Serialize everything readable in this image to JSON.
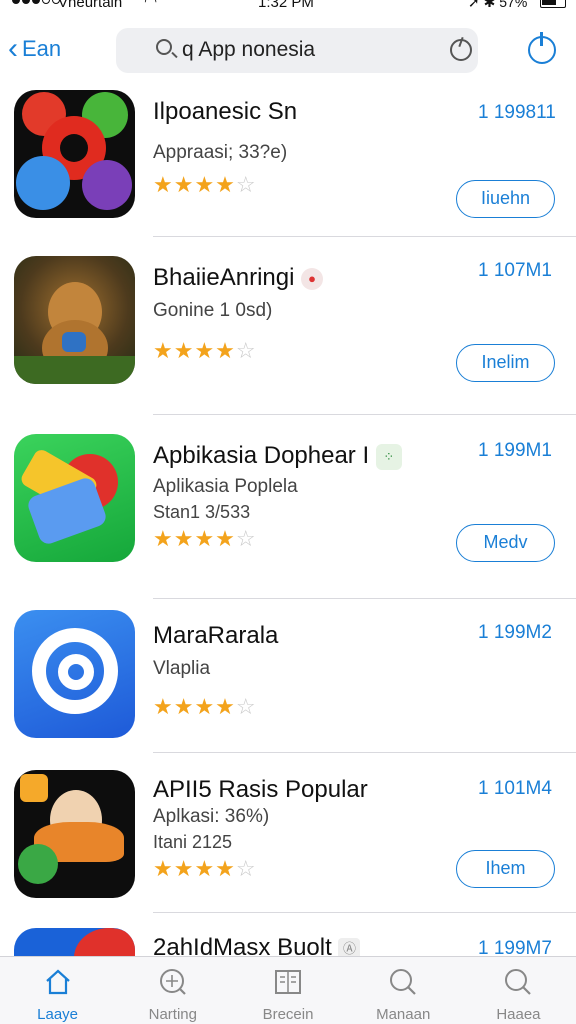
{
  "status_bar": {
    "carrier": "Vneurtain",
    "time": "1:32 PM",
    "battery": "57%"
  },
  "header": {
    "back_label": "Ean",
    "search_value": "q App nonesia"
  },
  "apps": [
    {
      "title": "Ilpoanesic Sn",
      "subtitle": "Appraasi; 33?e)",
      "subtitle2": "",
      "rating": 4,
      "size": "1 199811",
      "button": "Iiuehn"
    },
    {
      "title": "BhaiieAnringi",
      "subtitle": "Gonine 1 0sd)",
      "subtitle2": "",
      "rating": 4,
      "size": "1 107M1",
      "button": "Inelim"
    },
    {
      "title": "Apbikasia Dophear I",
      "subtitle": "Aplikasia Poplela",
      "subtitle2": "Stan1 3/533",
      "rating": 4,
      "size": "1 199M1",
      "button": "Medv"
    },
    {
      "title": "MaraRarala",
      "subtitle": "Vlaplia",
      "subtitle2": "",
      "rating": 4,
      "size": "1 199M2",
      "button": ""
    },
    {
      "title": "APII5 Rasis Popular",
      "subtitle": "Aplkasi: 36%)",
      "subtitle2": "Itani 2125",
      "rating": 4,
      "size": "1 101M4",
      "button": "Ihem"
    },
    {
      "title": "2ahIdMasx Buolt",
      "subtitle": "",
      "subtitle2": "",
      "rating": 0,
      "size": "1 199M7",
      "button": ""
    }
  ],
  "tabs": [
    {
      "label": "Laaye",
      "icon": "home-icon",
      "active": true
    },
    {
      "label": "Narting",
      "icon": "compass-icon",
      "active": false
    },
    {
      "label": "Brecein",
      "icon": "book-icon",
      "active": false
    },
    {
      "label": "Manaan",
      "icon": "search-icon",
      "active": false
    },
    {
      "label": "Haaea",
      "icon": "search-icon",
      "active": false
    }
  ],
  "colors": {
    "accent": "#1a7fd6",
    "star": "#f3a31c",
    "star_off": "#c9c9c9"
  }
}
